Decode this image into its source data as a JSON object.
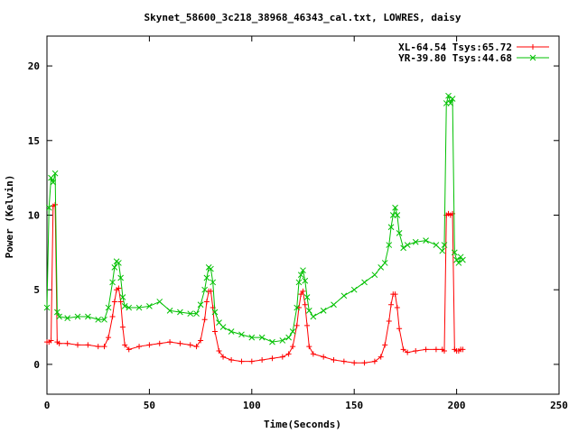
{
  "chart_data": {
    "type": "line",
    "title": "Skynet_58600_3c218_38968_46343_cal.txt, LOWRES, daisy",
    "xlabel": "Time(Seconds)",
    "ylabel": "Power (Kelvin)",
    "xlim": [
      0,
      250
    ],
    "ylim": [
      -2,
      22
    ],
    "xticks": [
      0,
      50,
      100,
      150,
      200,
      250
    ],
    "yticks": [
      0,
      5,
      10,
      15,
      20
    ],
    "grid": false,
    "legend_position": "top-right",
    "series": [
      {
        "name": "XL-64.54 Tsys:65.72",
        "color": "#ff0000",
        "marker": "plus",
        "x": [
          0,
          1,
          2,
          3,
          4,
          5,
          6,
          10,
          15,
          20,
          25,
          28,
          30,
          32,
          33,
          34,
          35,
          36,
          37,
          38,
          40,
          45,
          50,
          55,
          60,
          65,
          70,
          73,
          75,
          77,
          78,
          79,
          80,
          81,
          82,
          84,
          86,
          90,
          95,
          100,
          105,
          110,
          115,
          118,
          120,
          122,
          123,
          124,
          125,
          126,
          127,
          128,
          130,
          135,
          140,
          145,
          150,
          155,
          160,
          163,
          165,
          167,
          168,
          169,
          170,
          171,
          172,
          174,
          176,
          180,
          185,
          190,
          193,
          194,
          195,
          196,
          197,
          198,
          199,
          200,
          201,
          202,
          203
        ],
        "y": [
          1.5,
          1.5,
          1.6,
          10.6,
          10.7,
          1.5,
          1.4,
          1.4,
          1.3,
          1.3,
          1.2,
          1.2,
          1.8,
          3.2,
          4.2,
          5.0,
          5.1,
          4.2,
          2.5,
          1.3,
          1.0,
          1.2,
          1.3,
          1.4,
          1.5,
          1.4,
          1.3,
          1.2,
          1.6,
          3.0,
          4.2,
          4.9,
          4.9,
          3.8,
          2.2,
          0.9,
          0.5,
          0.3,
          0.2,
          0.2,
          0.3,
          0.4,
          0.5,
          0.7,
          1.2,
          2.6,
          3.8,
          4.7,
          4.9,
          4.0,
          2.6,
          1.2,
          0.7,
          0.5,
          0.3,
          0.2,
          0.1,
          0.1,
          0.2,
          0.5,
          1.3,
          2.9,
          4.0,
          4.7,
          4.7,
          3.8,
          2.4,
          1.0,
          0.8,
          0.9,
          1.0,
          1.0,
          1.0,
          0.9,
          10.0,
          10.1,
          10.0,
          10.1,
          1.0,
          0.9,
          0.9,
          1.0,
          1.0
        ]
      },
      {
        "name": "YR-39.80 Tsys:44.68",
        "color": "#00c000",
        "marker": "x",
        "x": [
          0,
          1,
          2,
          3,
          4,
          5,
          6,
          10,
          15,
          20,
          25,
          28,
          30,
          32,
          33,
          34,
          35,
          36,
          37,
          38,
          40,
          45,
          50,
          55,
          60,
          65,
          70,
          73,
          75,
          77,
          78,
          79,
          80,
          81,
          82,
          84,
          86,
          90,
          95,
          100,
          105,
          110,
          115,
          118,
          120,
          122,
          123,
          124,
          125,
          126,
          127,
          128,
          130,
          135,
          140,
          145,
          150,
          155,
          160,
          163,
          165,
          167,
          168,
          169,
          170,
          171,
          172,
          174,
          176,
          180,
          185,
          190,
          193,
          194,
          195,
          196,
          197,
          198,
          199,
          200,
          201,
          202,
          203
        ],
        "y": [
          3.8,
          10.5,
          12.5,
          12.2,
          12.8,
          3.5,
          3.2,
          3.1,
          3.2,
          3.2,
          3.0,
          3.0,
          3.8,
          5.5,
          6.5,
          6.9,
          6.8,
          5.8,
          4.5,
          3.9,
          3.8,
          3.8,
          3.9,
          4.2,
          3.6,
          3.5,
          3.4,
          3.4,
          4.0,
          5.0,
          5.8,
          6.5,
          6.4,
          5.5,
          3.5,
          2.8,
          2.5,
          2.2,
          2.0,
          1.8,
          1.8,
          1.5,
          1.6,
          1.8,
          2.2,
          3.8,
          5.5,
          6.0,
          6.3,
          5.6,
          4.5,
          3.6,
          3.2,
          3.6,
          4.0,
          4.6,
          5.0,
          5.5,
          6.0,
          6.5,
          6.8,
          8.0,
          9.2,
          10.0,
          10.5,
          10.0,
          8.8,
          7.8,
          8.0,
          8.2,
          8.3,
          8.0,
          7.6,
          8.0,
          17.5,
          18.0,
          17.5,
          17.8,
          7.5,
          7.0,
          6.8,
          7.2,
          7.0
        ]
      }
    ]
  }
}
